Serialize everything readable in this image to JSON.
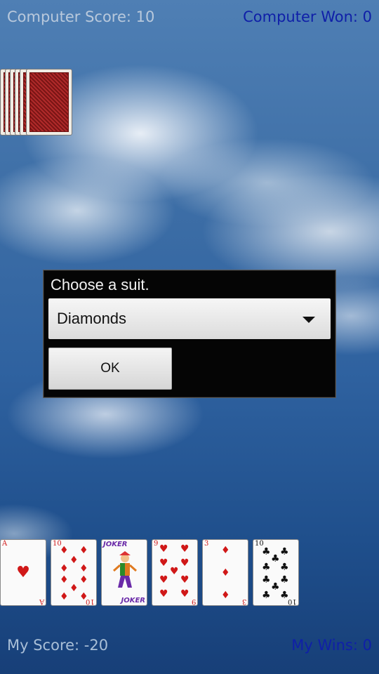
{
  "scores": {
    "computer_score": "Computer Score: 10",
    "computer_won": "Computer Won: 0",
    "my_score": "My Score: -20",
    "my_wins": "My Wins: 0"
  },
  "dialog": {
    "title": "Choose a suit.",
    "selected_suit": "Diamonds",
    "ok_label": "OK"
  },
  "hand": [
    {
      "rank": "A",
      "suit": "hearts",
      "symbol": "♥",
      "color": "#d01818"
    },
    {
      "rank": "10",
      "suit": "diamonds",
      "symbol": "♦",
      "color": "#d01818"
    },
    {
      "rank": "JOKER",
      "suit": "joker",
      "symbol": "",
      "color": "#6a2aa8"
    },
    {
      "rank": "9",
      "suit": "hearts",
      "symbol": "♥",
      "color": "#d01818"
    },
    {
      "rank": "3",
      "suit": "diamonds",
      "symbol": "♦",
      "color": "#d01818"
    },
    {
      "rank": "10",
      "suit": "clubs",
      "symbol": "♣",
      "color": "#111111"
    }
  ],
  "colors": {
    "computer_won": "#0f1fa8",
    "my_wins": "#0f1fa8",
    "dialog_bg": "#050505"
  }
}
